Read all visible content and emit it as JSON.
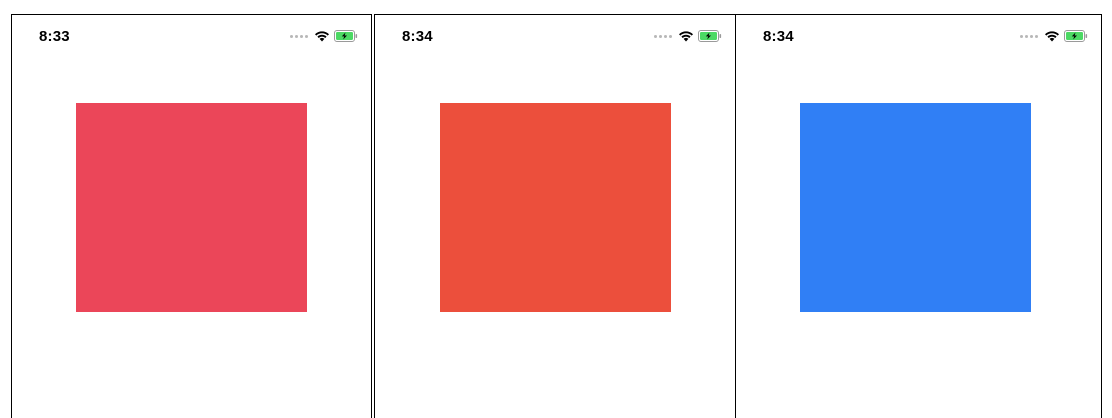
{
  "screens": [
    {
      "time": "8:33",
      "block_color": "#EB4659"
    },
    {
      "time": "8:34",
      "block_color": "#EC4F3C"
    },
    {
      "time": "8:34",
      "block_color": "#307FF5"
    }
  ],
  "status_icons": [
    "signal-dots-icon",
    "wifi-icon",
    "battery-charging-icon"
  ],
  "colors": {
    "battery_fill": "#4CD964",
    "frame_border": "#000000"
  }
}
